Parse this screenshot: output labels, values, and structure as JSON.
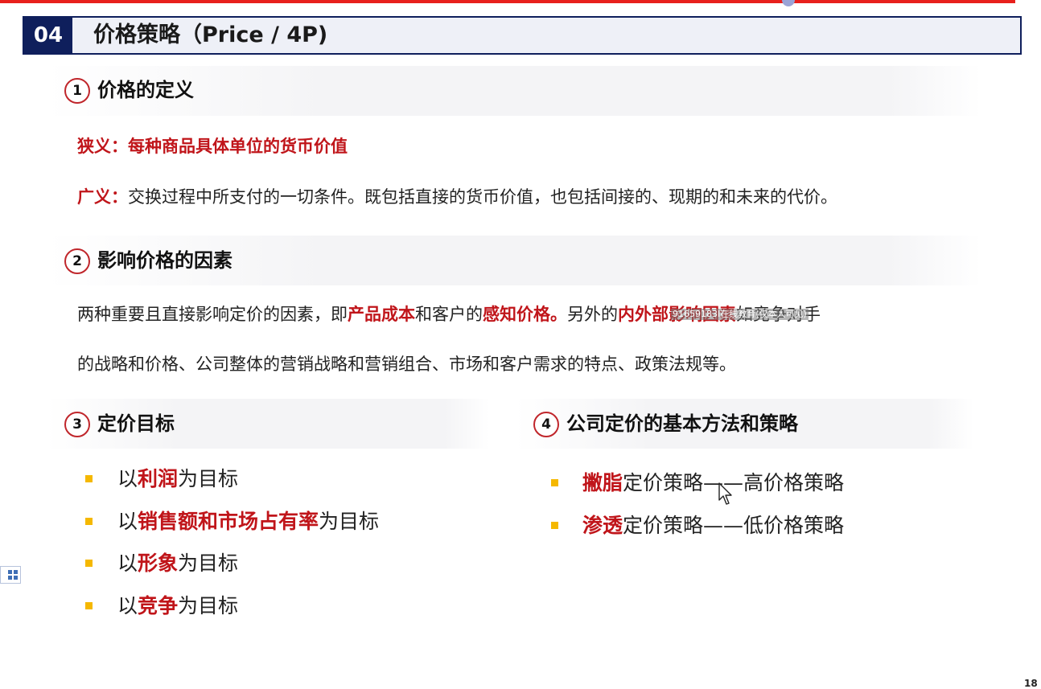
{
  "header": {
    "number": "04",
    "title": "价格策略（Price / 4P)"
  },
  "section1": {
    "num": "1",
    "title": "价格的定义",
    "narrow_label": "狭义：",
    "narrow_text": "每种商品具体单位的货币价值",
    "broad_label": "广义：",
    "broad_text": "交换过程中所支付的一切条件。既包括直接的货币价值，也包括间接的、现期的和未来的代价。"
  },
  "section2": {
    "num": "2",
    "title": "影响价格的因素",
    "p1_a": "两种重要且直接影响定价的因素，即",
    "p1_b": "产品成本",
    "p1_c": "和客户的",
    "p1_d": "感知价格。",
    "p1_e": "另外的",
    "p1_f": "内外部影响因素",
    "p1_g": "如竞争对手",
    "p2": "的战略和价格、公司整体的营销战略和营销组合、市场和客户需求的特点、政策法规等。"
  },
  "section3": {
    "num": "3",
    "title": "定价目标",
    "items": [
      {
        "pre": "以",
        "key": "利润",
        "post": "为目标"
      },
      {
        "pre": "以",
        "key": "销售额和市场占有率",
        "post": "为目标"
      },
      {
        "pre": "以",
        "key": "形象",
        "post": "为目标"
      },
      {
        "pre": "以",
        "key": "竞争",
        "post": "为目标"
      }
    ]
  },
  "section4": {
    "num": "4",
    "title": "公司定价的基本方法和策略",
    "items": [
      {
        "key": "撇脂",
        "post": "定价策略——高价格策略"
      },
      {
        "key": "渗透",
        "post": "定价策略——低价格策略"
      }
    ]
  },
  "overlay": {
    "text": "91659183I在线教育(仅本人可见)"
  },
  "page_number": "18",
  "colors": {
    "accent_red": "#c0151a",
    "header_navy": "#0f1f5c",
    "bullet": "#f5b800",
    "top_bar": "#e8201c"
  },
  "icons": {
    "cursor": "mouse-pointer-icon",
    "side": "grid-icon"
  }
}
